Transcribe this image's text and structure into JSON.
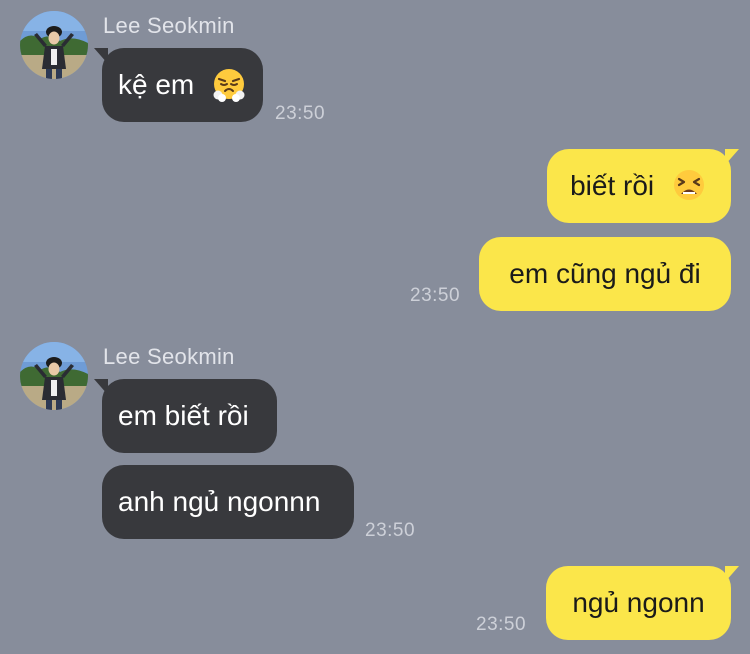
{
  "chat": {
    "background": "#878d9b",
    "incoming_bubble_color": "#38393d",
    "outgoing_bubble_color": "#fbe64a",
    "groups": [
      {
        "sender": "Lee Seokmin",
        "messages": [
          {
            "text": "kệ em",
            "emoji": "face-with-steam-from-nose"
          }
        ],
        "time": "23:50"
      },
      {
        "messages": [
          {
            "text": "biết rồi",
            "emoji": "tired-face"
          },
          {
            "text": "em cũng ngủ đi"
          }
        ],
        "time": "23:50"
      },
      {
        "sender": "Lee Seokmin",
        "messages": [
          {
            "text": "em biết rồi"
          },
          {
            "text": "anh ngủ ngonnn"
          }
        ],
        "time": "23:50"
      },
      {
        "messages": [
          {
            "text": "ngủ ngonn"
          }
        ],
        "time": "23:50"
      }
    ]
  }
}
